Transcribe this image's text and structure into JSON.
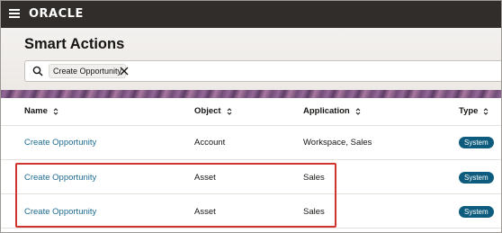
{
  "app": {
    "logo_text": "ORACLE"
  },
  "page": {
    "title": "Smart Actions"
  },
  "search": {
    "chip_label": "Create Opportunity"
  },
  "table": {
    "columns": [
      "Name",
      "Object",
      "Application",
      "Type"
    ],
    "rows": [
      {
        "name": "Create Opportunity",
        "object": "Account",
        "application": "Workspace, Sales",
        "type": "System"
      },
      {
        "name": "Create Opportunity",
        "object": "Asset",
        "application": "Sales",
        "type": "System"
      },
      {
        "name": "Create Opportunity",
        "object": "Asset",
        "application": "Sales",
        "type": "System"
      }
    ]
  },
  "icons": [
    "hamburger-menu-icon",
    "search-icon",
    "close-icon",
    "sort-icon"
  ],
  "colors": {
    "topbar": "#312d2a",
    "link": "#1d6b8f",
    "badge": "#0d5c7d",
    "highlight": "#d0342c"
  }
}
